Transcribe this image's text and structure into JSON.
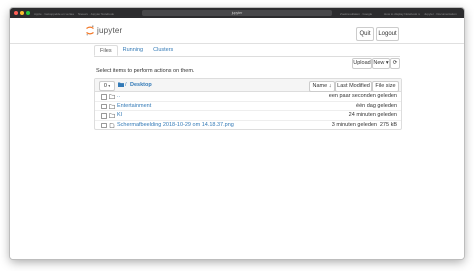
{
  "browser": {
    "address": "jupyter",
    "tabs": [
      "Apple · Gekoppelde en vertaalde pagina's",
      "Nieuws · Jupyter Notebook",
      "Zoekresultaten · Google",
      "How to display Notebook name",
      "Jupyter · Documentation"
    ]
  },
  "header": {
    "logo_text": "jupyter",
    "quit_label": "Quit",
    "logout_label": "Logout"
  },
  "tabs": [
    {
      "label": "Files",
      "active": true
    },
    {
      "label": "Running",
      "active": false
    },
    {
      "label": "Clusters",
      "active": false
    }
  ],
  "toolbar": {
    "info": "Select items to perform actions on them.",
    "upload_label": "Upload",
    "new_label": "New ▾",
    "refresh_icon": "refresh-icon"
  },
  "list_header": {
    "select_count": "0",
    "breadcrumb_root_icon": "folder-icon",
    "breadcrumb_sep": "/",
    "breadcrumb_dir": "Desktop",
    "sort_name": "Name ↓",
    "sort_modified": "Last Modified",
    "sort_size": "File size"
  },
  "files": [
    {
      "name": "..",
      "modified": "een paar seconden geleden",
      "size": "",
      "type": "folder"
    },
    {
      "name": "Entertainment",
      "modified": "één dag geleden",
      "size": "",
      "type": "folder"
    },
    {
      "name": "KI",
      "modified": "24 minuten geleden",
      "size": "",
      "type": "folder"
    },
    {
      "name": "Schermafbeelding 2018-10-29 om 14.18.37.png",
      "modified": "3 minuten geleden",
      "size": "275 kB",
      "type": "file"
    }
  ],
  "colors": {
    "link": "#337ab7",
    "jupyter_orange": "#f37726",
    "chrome": "#2c2c2e"
  }
}
